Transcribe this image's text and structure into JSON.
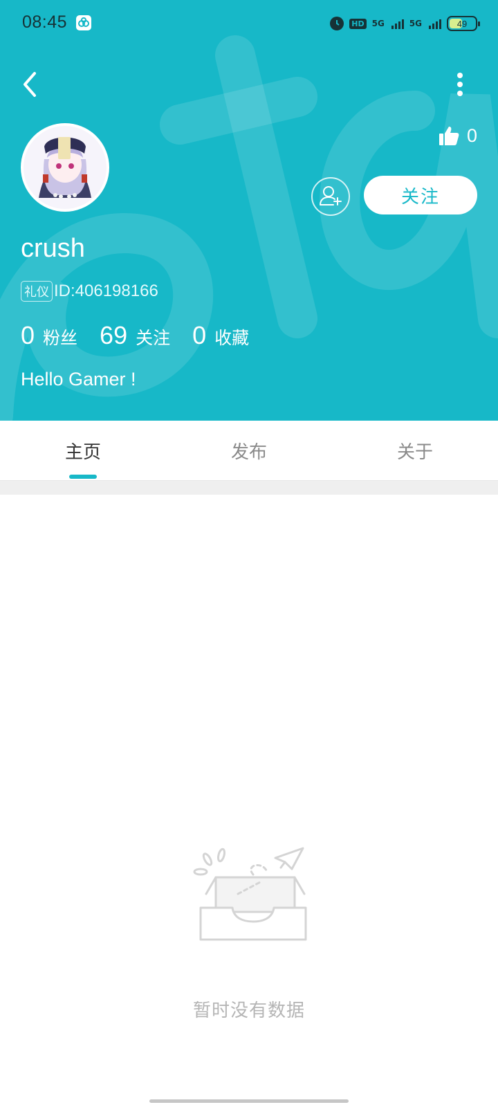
{
  "status_bar": {
    "time": "08:45",
    "net_1": "5G",
    "net_2": "5G",
    "hd_label": "HD",
    "battery": "49",
    "battery_level": 0.49
  },
  "colors": {
    "accent": "#17b8c8",
    "tab_indicator": "#17b8c8",
    "empty_text": "#b5b5b5"
  },
  "profile": {
    "like_count": "0",
    "follow_label": "关注",
    "username": "crush",
    "badge": "礼仪",
    "id_text": "ID:406198166",
    "bio": "Hello Gamer !",
    "stats": [
      {
        "num": "0",
        "label": "粉丝"
      },
      {
        "num": "69",
        "label": "关注"
      },
      {
        "num": "0",
        "label": "收藏"
      }
    ]
  },
  "tabs": [
    {
      "label": "主页",
      "active": true
    },
    {
      "label": "发布",
      "active": false
    },
    {
      "label": "关于",
      "active": false
    }
  ],
  "empty_state": {
    "text": "暂时没有数据",
    "icon": "empty-inbox-icon"
  },
  "icons": {
    "back": "back-arrow-icon",
    "more": "more-vertical-icon",
    "like": "thumbs-up-icon",
    "add_friend": "add-user-icon"
  }
}
